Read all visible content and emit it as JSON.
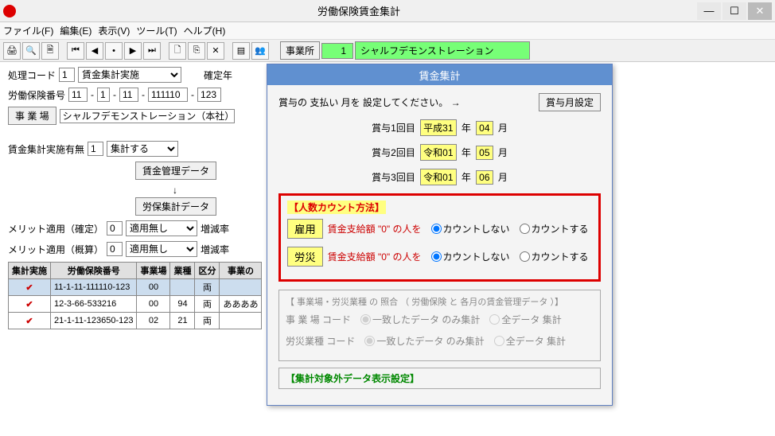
{
  "window": {
    "title": "労働保険賃金集計"
  },
  "menu": {
    "file": "ファイル(F)",
    "edit": "編集(E)",
    "view": "表示(V)",
    "tool": "ツール(T)",
    "help": "ヘルプ(H)"
  },
  "toolbar": {
    "office_label": "事業所",
    "office_num": "1",
    "office_name": "シャルフデモンストレーション"
  },
  "main": {
    "proc_code_label": "処理コード",
    "proc_code": "1",
    "proc_select": "賃金集計実施",
    "kakutei_label": "確定年",
    "ins_no_label": "労働保険番号",
    "ins_no": [
      "11",
      "1",
      "11",
      "111110",
      "123"
    ],
    "workplace_btn": "事 業 場",
    "workplace_name": "シャルフデモンストレーション（本社）",
    "aggr_flag_label": "賃金集計実施有無",
    "aggr_flag": "1",
    "aggr_sel": "集計する",
    "mgmt_btn": "賃金管理データ",
    "aggr_btn": "労保集計データ",
    "merit_k_label": "メリット適用（確定）",
    "merit_k": "0",
    "merit_k_sel": "適用無し",
    "merit_g_label": "メリット適用（概算）",
    "merit_g": "0",
    "merit_g_sel": "適用無し",
    "rate_label": "増減率",
    "table": {
      "headers": [
        "集計実施",
        "労働保険番号",
        "事業場",
        "業種",
        "区分",
        "事業の"
      ],
      "rows": [
        {
          "chk": "✔",
          "no": "11-1-11-111110-123",
          "wp": "00",
          "ind": "",
          "cls": "両",
          "name": ""
        },
        {
          "chk": "✔",
          "no": "12-3-66-533216",
          "wp": "00",
          "ind": "94",
          "cls": "両",
          "name": "ああああ"
        },
        {
          "chk": "✔",
          "no": "21-1-11-123650-123",
          "wp": "02",
          "ind": "21",
          "cls": "両",
          "name": ""
        }
      ]
    }
  },
  "dialog": {
    "title": "賃金集計",
    "bonus_prompt": "賞与の 支払い 月を 設定してください。 →",
    "bonus_btn": "賞与月設定",
    "bonus_rows": [
      {
        "label": "賞与1回目",
        "era": "平成31",
        "y": "年",
        "m": "04",
        "mu": "月"
      },
      {
        "label": "賞与2回目",
        "era": "令和01",
        "y": "年",
        "m": "05",
        "mu": "月"
      },
      {
        "label": "賞与3回目",
        "era": "令和01",
        "y": "年",
        "m": "06",
        "mu": "月"
      }
    ],
    "count_legend": "【人数カウント方法】",
    "emp_btn": "雇用",
    "acc_btn": "労災",
    "zero_text": "賃金支給額 \"0\" の人を",
    "opt_no": "カウントしない",
    "opt_yes": "カウントする",
    "match_legend": "【 事業場・労災業種 の 照合 （ 労働保険 と 各月の賃金管理データ ）】",
    "wp_code_label": "事 業 場 コード",
    "ind_code_label": "労災業種 コード",
    "opt_match": "一致したデータ のみ集計",
    "opt_all": "全データ 集計",
    "excl_legend": "【集計対象外データ表示設定】"
  }
}
